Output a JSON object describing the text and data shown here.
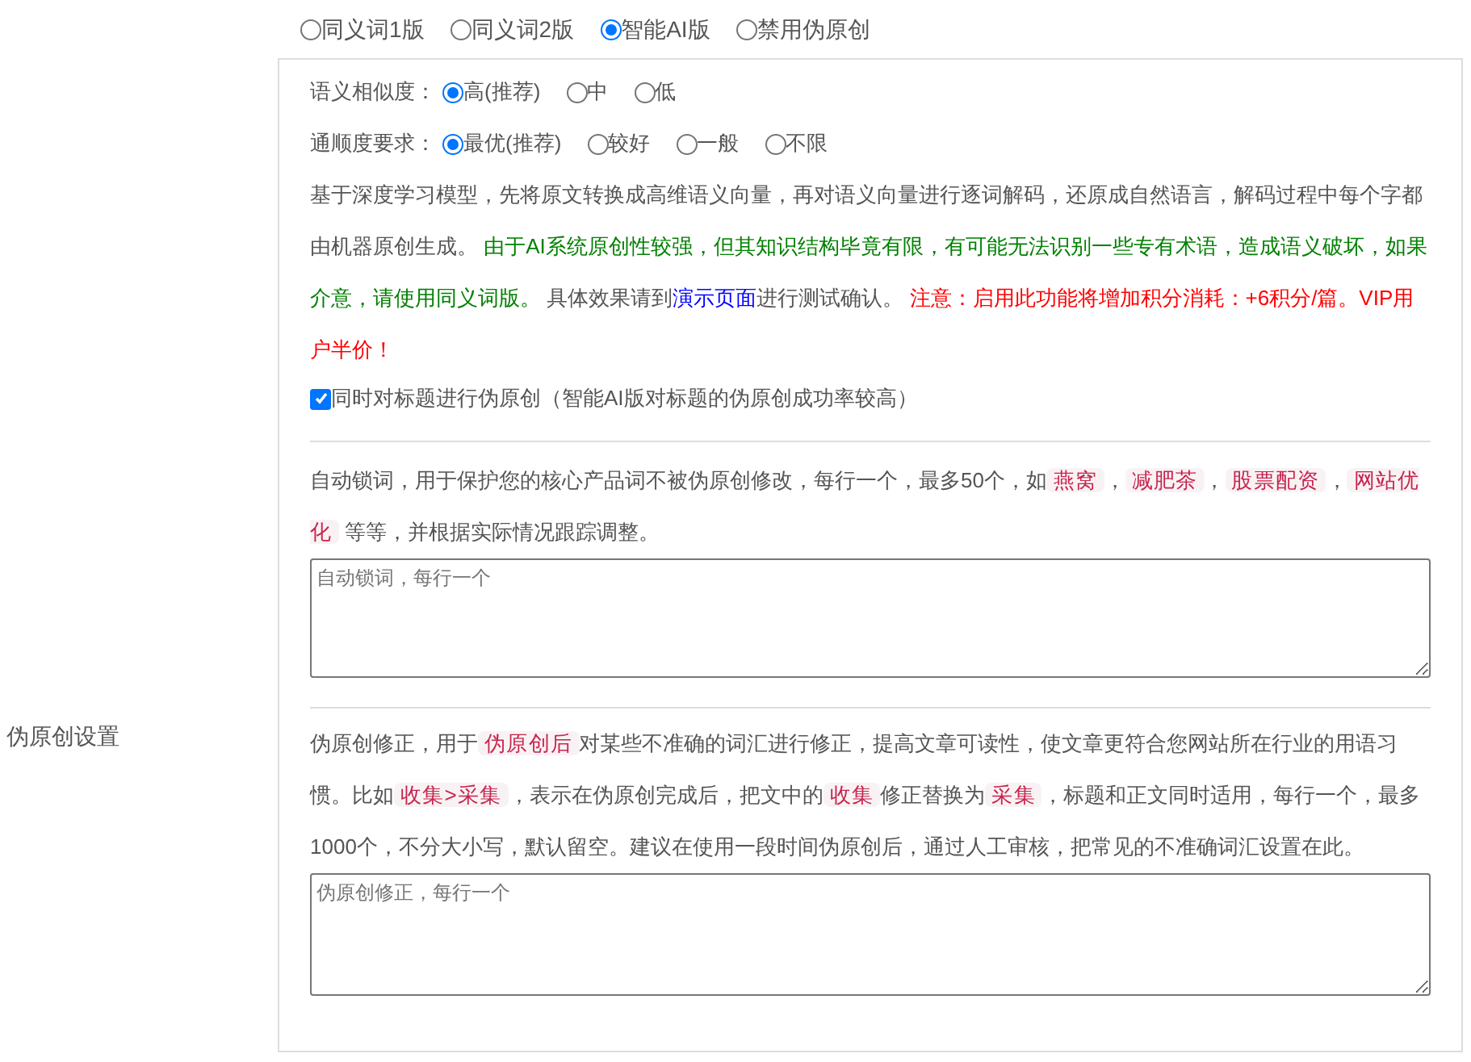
{
  "side_label": "伪原创设置",
  "mode_options": [
    {
      "label": "同义词1版",
      "selected": false
    },
    {
      "label": "同义词2版",
      "selected": false
    },
    {
      "label": "智能AI版",
      "selected": true
    },
    {
      "label": "禁用伪原创",
      "selected": false
    }
  ],
  "similarity": {
    "label": "语义相似度：",
    "options": [
      {
        "label": "高(推荐)",
        "selected": true
      },
      {
        "label": "中",
        "selected": false
      },
      {
        "label": "低",
        "selected": false
      }
    ]
  },
  "fluency": {
    "label": "通顺度要求：",
    "options": [
      {
        "label": "最优(推荐)",
        "selected": true
      },
      {
        "label": "较好",
        "selected": false
      },
      {
        "label": "一般",
        "selected": false
      },
      {
        "label": "不限",
        "selected": false
      }
    ]
  },
  "description": [
    {
      "kind": "text",
      "text": "基于深度学习模型，先将原文转换成高维语义向量，再对语义向量进行逐词解码，还原成自然语言，解码过程中每个字都由机器原创生成。 "
    },
    {
      "kind": "note",
      "text": "由于AI系统原创性较强，但其知识结构毕竟有限，有可能无法识别一些专有术语，造成语义破坏，如果介意，请使用同义词版。"
    },
    {
      "kind": "text",
      "text": " 具体效果请到"
    },
    {
      "kind": "link",
      "text": "演示页面"
    },
    {
      "kind": "text",
      "text": "进行测试确认。 "
    },
    {
      "kind": "warning",
      "text": "注意：启用此功能将增加积分消耗：+6积分/篇。VIP用户半价！"
    }
  ],
  "title_checkbox": {
    "label": "同时对标题进行伪原创（智能AI版对标题的伪原创成功率较高）",
    "checked": true
  },
  "lock_words": {
    "description": [
      {
        "kind": "text",
        "text": "自动锁词，用于保护您的核心产品词不被伪原创修改，每行一个，最多50个，如"
      },
      {
        "kind": "tag",
        "text": "燕窝"
      },
      {
        "kind": "text",
        "text": "，"
      },
      {
        "kind": "tag",
        "text": "减肥茶"
      },
      {
        "kind": "text",
        "text": "，"
      },
      {
        "kind": "tag",
        "text": "股票配资"
      },
      {
        "kind": "text",
        "text": "，"
      },
      {
        "kind": "tag",
        "text": "网站优化"
      },
      {
        "kind": "text",
        "text": " 等等，并根据实际情况跟踪调整。"
      }
    ],
    "placeholder": "自动锁词，每行一个"
  },
  "correction": {
    "description": [
      {
        "kind": "text",
        "text": "伪原创修正，用于"
      },
      {
        "kind": "tag",
        "text": "伪原创后"
      },
      {
        "kind": "text",
        "text": "对某些不准确的词汇进行修正，提高文章可读性，使文章更符合您网站所在行业的用语习惯。比如"
      },
      {
        "kind": "tag",
        "text": "收集>采集"
      },
      {
        "kind": "text",
        "text": "，表示在伪原创完成后，把文中的"
      },
      {
        "kind": "tag",
        "text": "收集"
      },
      {
        "kind": "text",
        "text": "修正替换为"
      },
      {
        "kind": "tag",
        "text": "采集"
      },
      {
        "kind": "text",
        "text": "，标题和正文同时适用，每行一个，最多1000个，不分大小写，默认留空。建议在使用一段时间伪原创后，通过人工审核，把常见的不准确词汇设置在此。"
      }
    ],
    "placeholder": "伪原创修正，每行一个"
  }
}
